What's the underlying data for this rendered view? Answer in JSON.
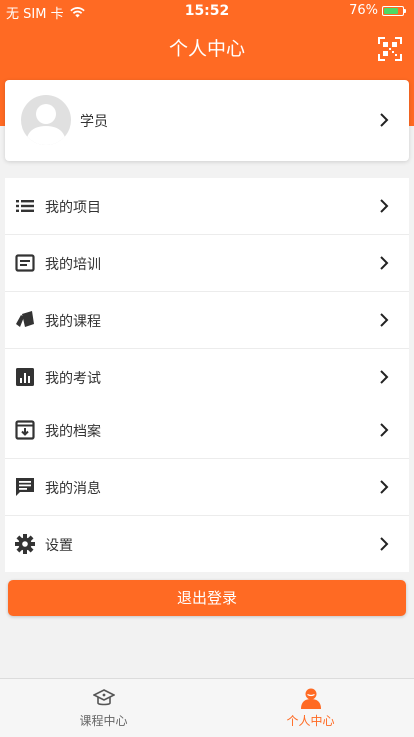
{
  "status_bar": {
    "carrier": "无 SIM 卡",
    "time": "15:52",
    "battery": "76%",
    "battery_level": 0.76
  },
  "header": {
    "title": "个人中心",
    "scan_icon": "qr-scan-icon"
  },
  "profile": {
    "name": "学员",
    "avatar_icon": "default-avatar-icon"
  },
  "menu_groups": [
    [
      {
        "label": "我的项目",
        "icon": "list-icon"
      },
      {
        "label": "我的培训",
        "icon": "document-icon"
      },
      {
        "label": "我的课程",
        "icon": "cards-icon"
      },
      {
        "label": "我的考试",
        "icon": "bar-chart-icon"
      }
    ],
    [
      {
        "label": "我的档案",
        "icon": "archive-download-icon"
      },
      {
        "label": "我的消息",
        "icon": "message-icon"
      },
      {
        "label": "设置",
        "icon": "gear-icon"
      }
    ]
  ],
  "logout": {
    "label": "退出登录"
  },
  "tabbar": {
    "tabs": [
      {
        "label": "课程中心",
        "icon": "graduation-cap-icon",
        "active": false
      },
      {
        "label": "个人中心",
        "icon": "person-icon",
        "active": true
      }
    ]
  },
  "colors": {
    "accent": "#ff6a23",
    "background": "#f2f2f2",
    "battery": "#4cd964"
  }
}
